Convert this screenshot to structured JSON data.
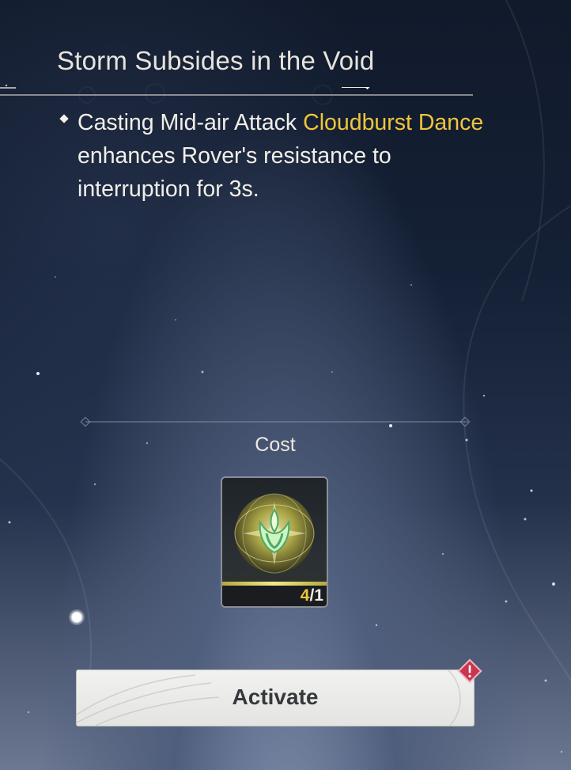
{
  "node": {
    "title": "Storm Subsides in the Void",
    "description": {
      "part1": "Casting Mid-air Attack ",
      "highlight": "Cloudburst Dance",
      "part2": " enhances Rover's resistance to interruption for 3s."
    }
  },
  "cost": {
    "label": "Cost",
    "item": {
      "icon": "resonance-item-icon",
      "owned": "4",
      "separator": "/",
      "required": "1"
    }
  },
  "actions": {
    "activate_label": "Activate",
    "alert_icon": "exclamation-diamond-icon"
  },
  "colors": {
    "highlight": "#f0c53d",
    "text": "#f2efe8",
    "alert": "#c8364f"
  }
}
